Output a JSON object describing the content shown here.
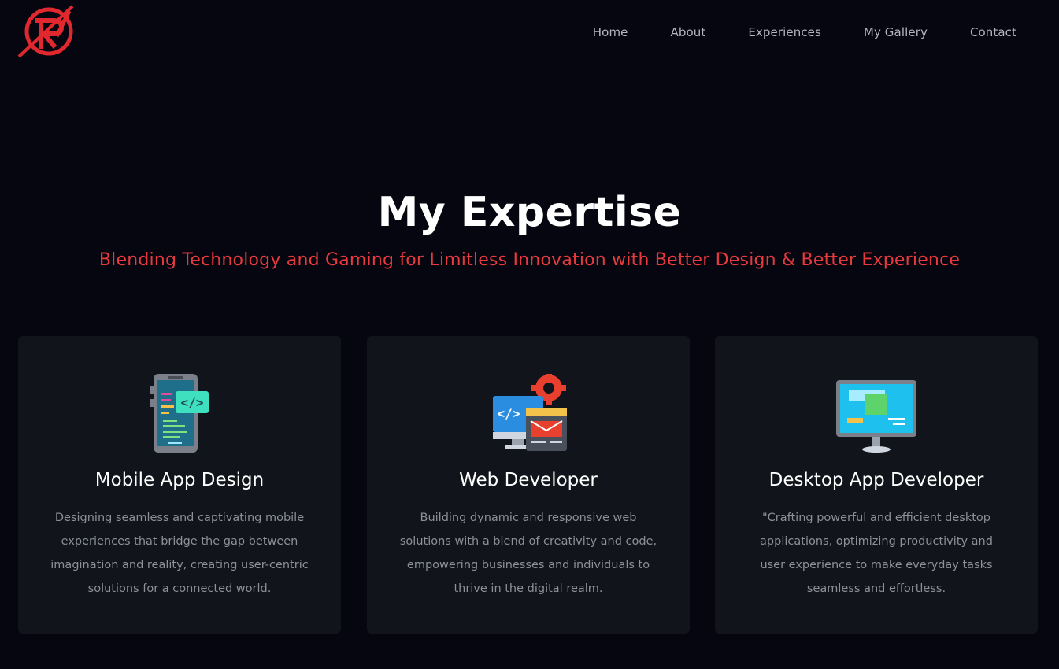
{
  "nav": {
    "items": [
      "Home",
      "About",
      "Experiences",
      "My Gallery",
      "Contact"
    ]
  },
  "hero": {
    "title": "My Expertise",
    "subtitle": "Blending Technology and Gaming for Limitless Innovation with Better Design & Better Experience"
  },
  "cards": [
    {
      "icon": "mobile-code-icon",
      "title": "Mobile App Design",
      "description": "Designing seamless and captivating mobile experiences that bridge the gap between imagination and reality, creating user-centric solutions for a connected world."
    },
    {
      "icon": "web-developer-icon",
      "title": "Web Developer",
      "description": "Building dynamic and responsive web solutions with a blend of creativity and code, empowering businesses and individuals to thrive in the digital realm."
    },
    {
      "icon": "desktop-monitor-icon",
      "title": "Desktop App Developer",
      "description": "\"Crafting powerful and efficient desktop applications, optimizing productivity and user experience to make everyday tasks seamless and effortless."
    }
  ],
  "colors": {
    "background": "#05060f",
    "card": "#11141a",
    "accent": "#e8393d"
  }
}
